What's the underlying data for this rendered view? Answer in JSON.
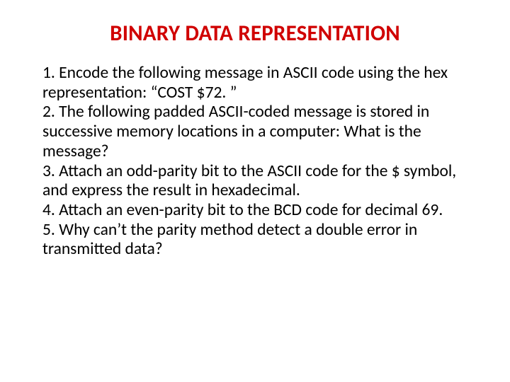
{
  "title": "BINARY DATA REPRESENTATION",
  "items": [
    "1. Encode the following message in ASCII code using the hex representation: “COST $72. ”",
    "2. The following padded ASCII-coded message is stored in successive memory locations in a computer: What is the message?",
    "3. Attach an odd-parity bit to the ASCII code for the $ symbol, and express the result in hexadecimal.",
    "4. Attach an even-parity bit to the BCD code for decimal 69.",
    "5. Why can’t the parity method detect a double error in transmitted data?"
  ]
}
